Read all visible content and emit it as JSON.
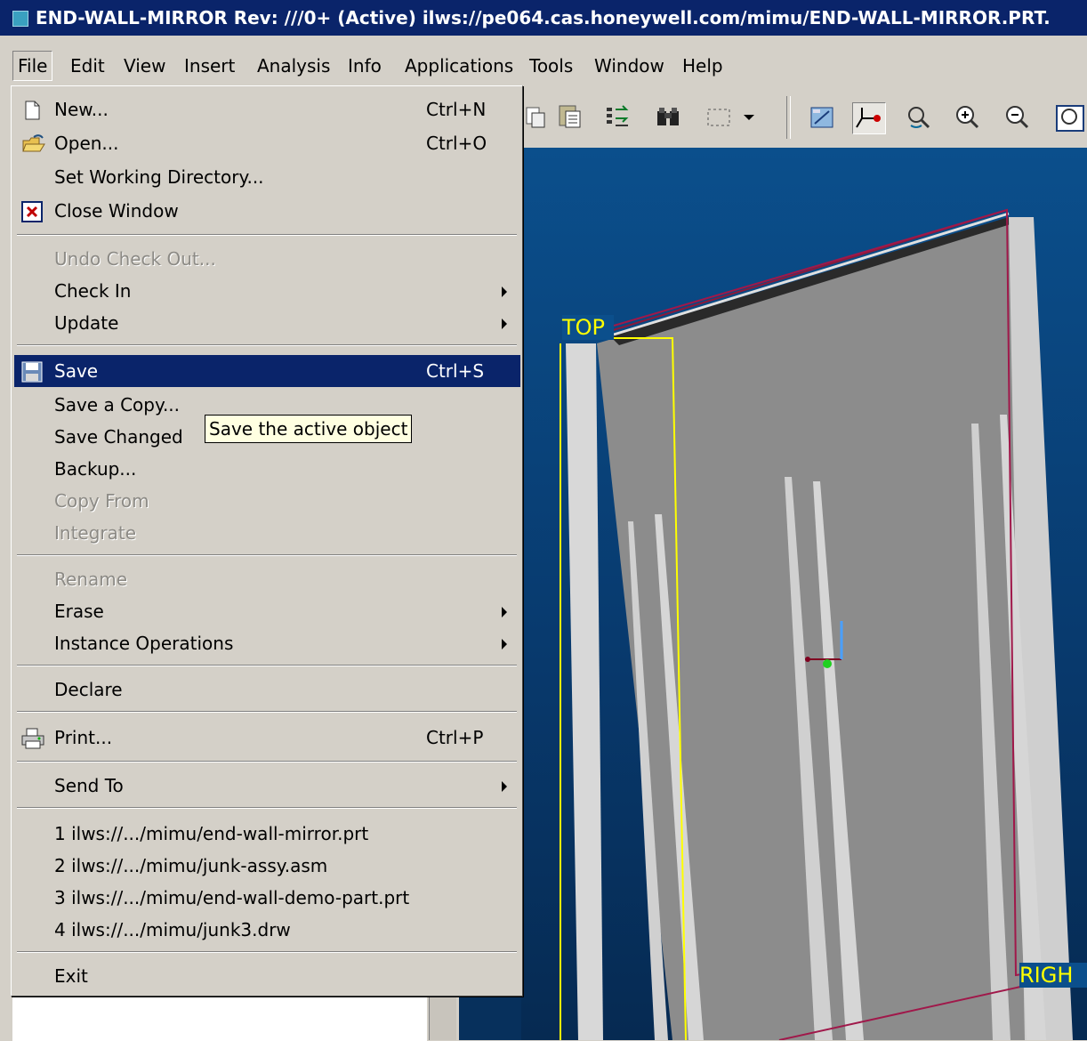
{
  "window": {
    "title": "END-WALL-MIRROR Rev: ///0+ (Active) ilws://pe064.cas.honeywell.com/mimu/END-WALL-MIRROR.PRT."
  },
  "menubar": {
    "items": [
      "File",
      "Edit",
      "View",
      "Insert",
      "Analysis",
      "Info",
      "Applications",
      "Tools",
      "Window",
      "Help"
    ],
    "active": "File"
  },
  "file_menu": {
    "new": {
      "label": "New...",
      "shortcut": "Ctrl+N"
    },
    "open": {
      "label": "Open...",
      "shortcut": "Ctrl+O"
    },
    "set_working_directory": {
      "label": "Set Working Directory..."
    },
    "close_window": {
      "label": "Close Window"
    },
    "undo_check_out": {
      "label": "Undo Check Out..."
    },
    "check_in": {
      "label": "Check In"
    },
    "update": {
      "label": "Update"
    },
    "save": {
      "label": "Save",
      "shortcut": "Ctrl+S"
    },
    "save_a_copy": {
      "label": "Save a Copy..."
    },
    "save_changed": {
      "label": "Save Changed"
    },
    "backup": {
      "label": "Backup..."
    },
    "copy_from": {
      "label": "Copy From"
    },
    "integrate": {
      "label": "Integrate"
    },
    "rename": {
      "label": "Rename"
    },
    "erase": {
      "label": "Erase"
    },
    "instance_operations": {
      "label": "Instance Operations"
    },
    "declare": {
      "label": "Declare"
    },
    "print": {
      "label": "Print...",
      "shortcut": "Ctrl+P"
    },
    "send_to": {
      "label": "Send To"
    },
    "recent": [
      "1 ilws://.../mimu/end-wall-mirror.prt",
      "2 ilws://.../mimu/junk-assy.asm",
      "3 ilws://.../mimu/end-wall-demo-part.prt",
      "4 ilws://.../mimu/junk3.drw"
    ],
    "exit": {
      "label": "Exit"
    }
  },
  "tooltip": "Save the active object",
  "viewport": {
    "datum_labels": [
      "TOP",
      "RIGH"
    ]
  },
  "toolbar": {
    "icons": [
      "paste-icon",
      "paste-special-icon",
      "regenerate-icon",
      "find-icon",
      "selection-box-icon",
      "dropdown-arrow-icon",
      "repaint-icon",
      "spin-center-icon",
      "orient-mode-icon",
      "zoom-in-icon",
      "zoom-out-icon",
      "refit-icon"
    ]
  },
  "colors": {
    "title_bar": "#0a246a",
    "menu_highlight": "#0a246a",
    "menu_bg": "#d4d0c8",
    "viewport_bg": "#0b4f8c",
    "datum_label": "#ffff00",
    "tooltip_bg": "#ffffe1"
  }
}
